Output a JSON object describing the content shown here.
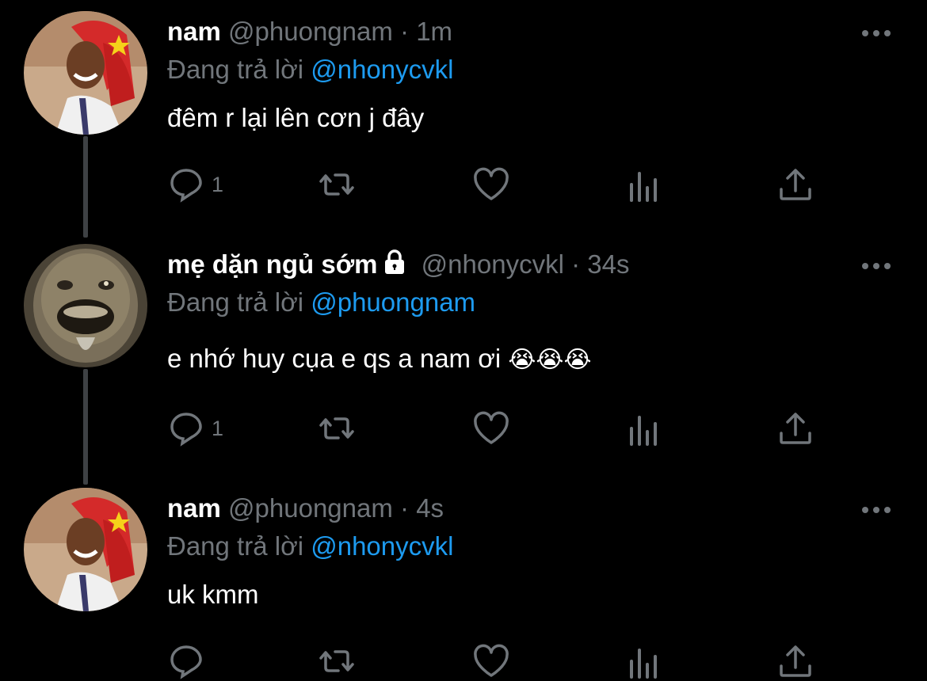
{
  "tweets": [
    {
      "name": "nam",
      "handle": "@phuongnam",
      "separator": "·",
      "time": "1m",
      "reply_prefix": "Đang trả lời",
      "reply_to": "@nhonycvkl",
      "text": "đêm r lại lên cơn j đây",
      "emojis": "",
      "reply_count": "1",
      "locked": false,
      "avatar": "man-red-hood-smiling"
    },
    {
      "name": "mẹ dặn ngủ sớm",
      "handle": "@nhonycvkl",
      "separator": "·",
      "time": "34s",
      "reply_prefix": "Đang trả lời",
      "reply_to": "@phuongnam",
      "text": "e nhớ huy cụa e qs a nam ơi",
      "emojis": "😭😭😭",
      "reply_count": "1",
      "locked": true,
      "avatar": "meme-face"
    },
    {
      "name": "nam",
      "handle": "@phuongnam",
      "separator": "·",
      "time": "4s",
      "reply_prefix": "Đang trả lời",
      "reply_to": "@nhonycvkl",
      "text": "uk kmm",
      "emojis": "",
      "reply_count": "",
      "locked": false,
      "avatar": "man-red-hood-smiling"
    }
  ],
  "colors": {
    "background": "#000000",
    "muted": "#71767b",
    "mention": "#1d9bf0",
    "thread_line": "#3e4144"
  },
  "icons": [
    "reply-icon",
    "retweet-icon",
    "like-icon",
    "views-icon",
    "share-icon",
    "more-icon",
    "lock-icon"
  ]
}
